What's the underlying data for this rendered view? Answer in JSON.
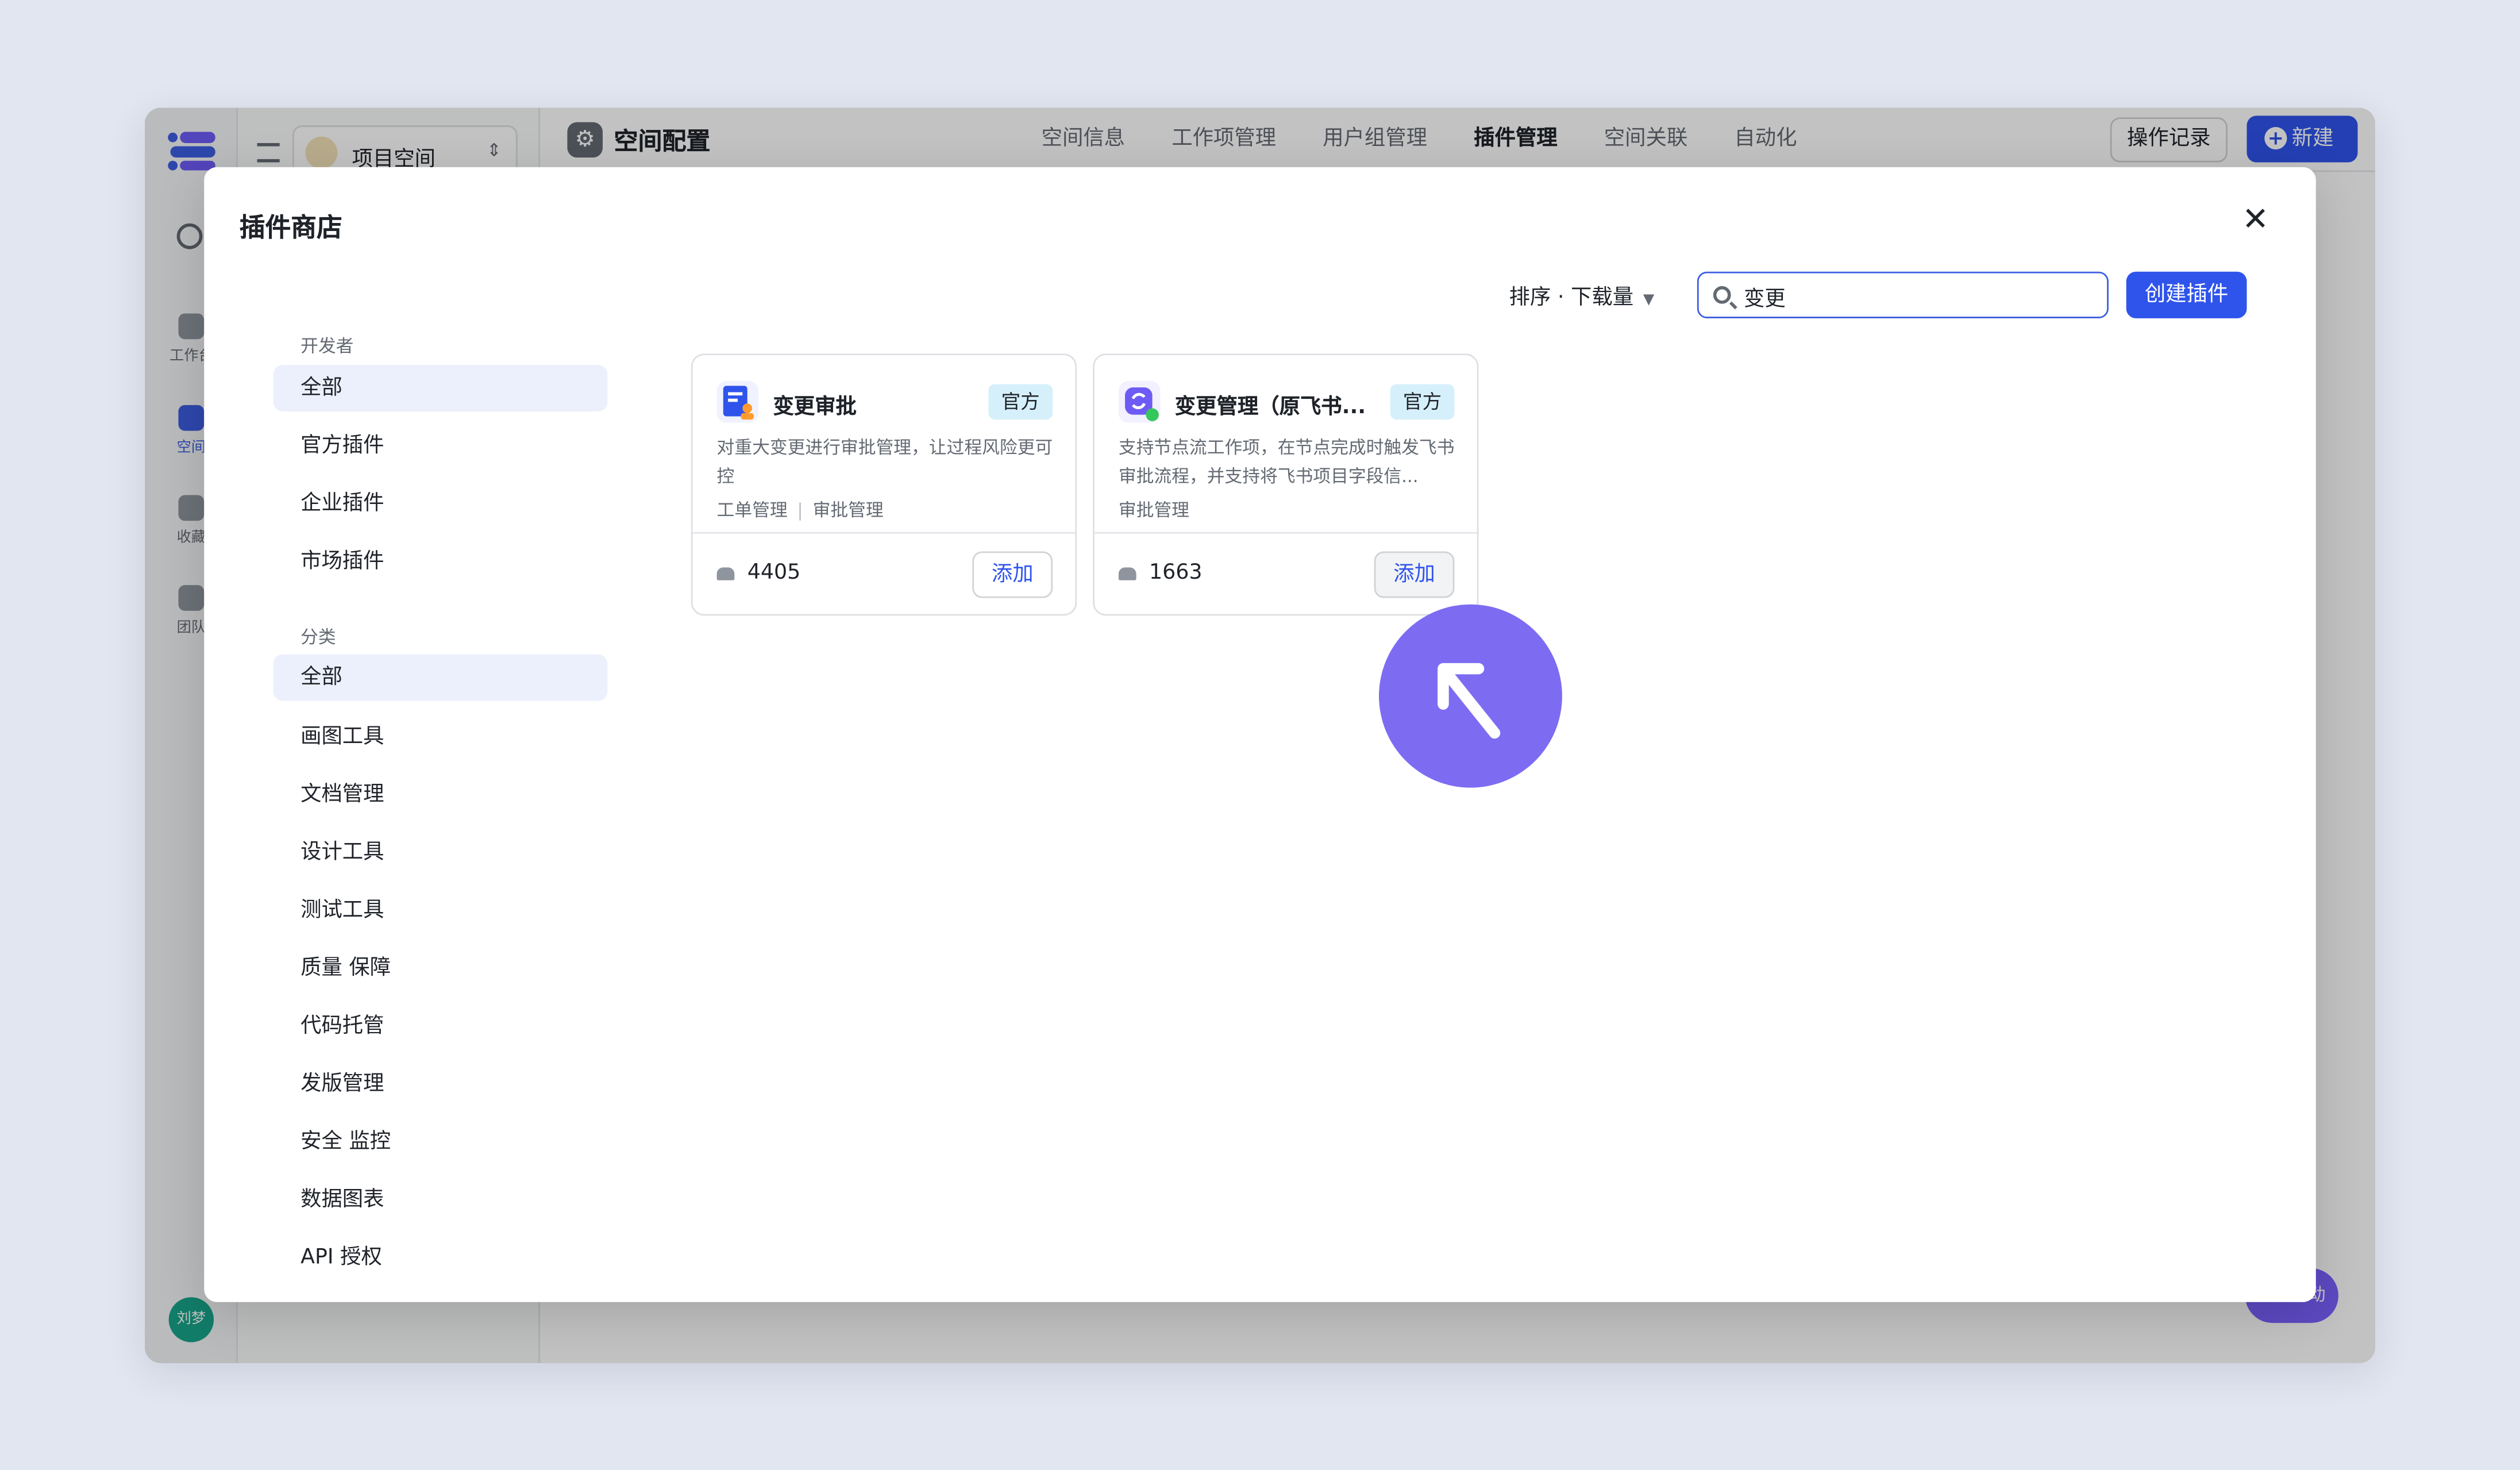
{
  "app": {
    "rail_items": [
      {
        "label": "工作台"
      },
      {
        "label": "空间"
      },
      {
        "label": "收藏"
      },
      {
        "label": "团队"
      }
    ],
    "user_avatar": "刘梦",
    "space_name": "项目空间"
  },
  "topbar": {
    "page_title": "空间配置",
    "tabs": [
      "空间信息",
      "工作项管理",
      "用户组管理",
      "插件管理",
      "空间关联",
      "自动化"
    ],
    "active_tab": "插件管理",
    "log_button": "操作记录",
    "new_button": "新建",
    "help_fab": "动"
  },
  "modal": {
    "title": "插件商店",
    "close_icon": "close-icon",
    "sort_label": "排序 · 下载量",
    "search": {
      "value": "变更",
      "placeholder": ""
    },
    "create_button": "创建插件",
    "filters": {
      "developer_label": "开发者",
      "developer_items": [
        "全部",
        "官方插件",
        "企业插件",
        "市场插件"
      ],
      "category_label": "分类",
      "category_items": [
        "全部",
        "画图工具",
        "文档管理",
        "设计工具",
        "测试工具",
        "质量 保障",
        "代码托管",
        "发版管理",
        "安全 监控",
        "数据图表",
        "API 授权"
      ]
    },
    "plugins": [
      {
        "name": "变更审批",
        "badge": "官方",
        "description": "对重大变更进行审批管理，让过程风险更可控",
        "tags": [
          "工单管理",
          "审批管理"
        ],
        "downloads": "4405",
        "action": "添加",
        "icon": "approval-doc-icon"
      },
      {
        "name": "变更管理（原飞书...",
        "badge": "官方",
        "description": "支持节点流工作项，在节点完成时触发飞书审批流程，并支持将飞书项目字段信...",
        "tags": [
          "审批管理"
        ],
        "downloads": "1663",
        "action": "添加",
        "icon": "change-sync-icon"
      }
    ]
  },
  "colors": {
    "accent": "#2f54eb",
    "selected_bg": "#ecf0fc",
    "badge_bg": "#d6f0fb",
    "cursor_highlight": "#7d6cf2"
  }
}
